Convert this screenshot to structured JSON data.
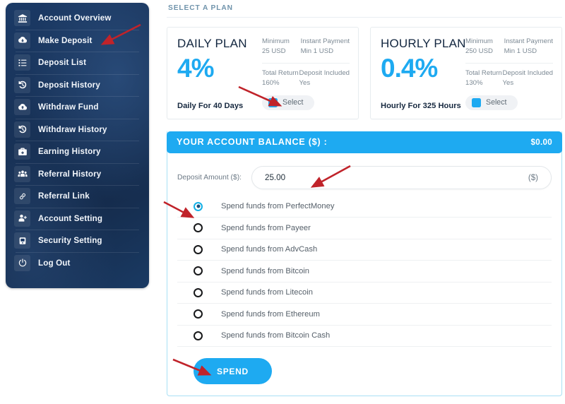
{
  "sidebar": {
    "items": [
      {
        "label": "Account Overview",
        "icon": "bank-icon"
      },
      {
        "label": "Make Deposit",
        "icon": "cloud-download-icon"
      },
      {
        "label": "Deposit List",
        "icon": "list-icon"
      },
      {
        "label": "Deposit History",
        "icon": "history-icon"
      },
      {
        "label": "Withdraw Fund",
        "icon": "cloud-upload-icon"
      },
      {
        "label": "Withdraw History",
        "icon": "history-icon"
      },
      {
        "label": "Earning History",
        "icon": "briefcase-icon"
      },
      {
        "label": "Referral History",
        "icon": "users-icon"
      },
      {
        "label": "Referral Link",
        "icon": "link-icon"
      },
      {
        "label": "Account Setting",
        "icon": "user-plus-icon"
      },
      {
        "label": "Security Setting",
        "icon": "lock-icon"
      },
      {
        "label": "Log Out",
        "icon": "power-icon"
      }
    ]
  },
  "main": {
    "section_title": "SELECT A PLAN",
    "plans": [
      {
        "name": "DAILY PLAN",
        "percent": "4%",
        "duration": "Daily For 40 Days",
        "minimum_key": "Minimum",
        "minimum_value": "25 USD",
        "payment_key": "Instant Payment",
        "payment_value": "Min 1 USD",
        "return_key": "Total Return",
        "return_value": "160%",
        "included_key": "Deposit Included",
        "included_value": "Yes",
        "select_label": "Select",
        "selected": true
      },
      {
        "name": "HOURLY PLAN",
        "percent": "0.4%",
        "duration": "Hourly For 325 Hours",
        "minimum_key": "Minimum",
        "minimum_value": "250 USD",
        "payment_key": "Instant Payment",
        "payment_value": "Min 1 USD",
        "return_key": "Total Return",
        "return_value": "130%",
        "included_key": "Deposit Included",
        "included_value": "Yes",
        "select_label": "Select",
        "selected": false
      }
    ],
    "balance": {
      "label": "YOUR ACCOUNT BALANCE ($) :",
      "amount": "$0.00"
    },
    "deposit": {
      "label": "Deposit Amount ($):",
      "value": "25.00",
      "placeholder": "0.00",
      "suffix": "($)"
    },
    "methods": [
      {
        "label": "Spend funds from PerfectMoney",
        "selected": true
      },
      {
        "label": "Spend funds from Payeer",
        "selected": false
      },
      {
        "label": "Spend funds from AdvCash",
        "selected": false
      },
      {
        "label": "Spend funds from Bitcoin",
        "selected": false
      },
      {
        "label": "Spend funds from Litecoin",
        "selected": false
      },
      {
        "label": "Spend funds from Ethereum",
        "selected": false
      },
      {
        "label": "Spend funds from Bitcoin Cash",
        "selected": false
      }
    ],
    "spend_label": "SPEND"
  },
  "colors": {
    "accent": "#1eaaf1",
    "sidebar_dark": "#183257",
    "section_title": "#6f93ab",
    "annotation_arrow": "#c0232a"
  }
}
